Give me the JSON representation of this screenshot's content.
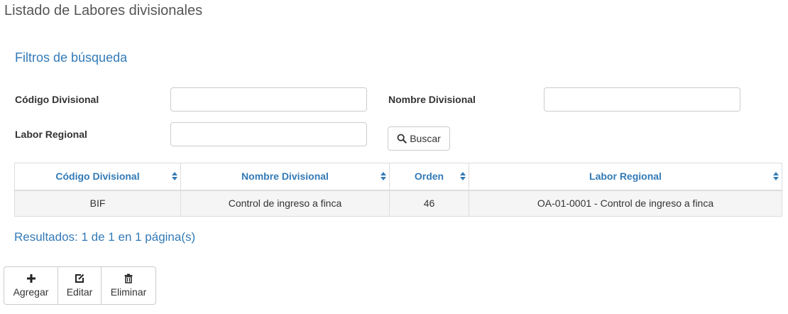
{
  "page": {
    "title": "Listado de Labores divisionales"
  },
  "filters": {
    "title": "Filtros de búsqueda",
    "codigo_label": "Código Divisional",
    "codigo_value": "",
    "nombre_label": "Nombre Divisional",
    "nombre_value": "",
    "labor_label": "Labor Regional",
    "labor_value": "",
    "search_label": "Buscar"
  },
  "table": {
    "columns": [
      "Código Divisional",
      "Nombre Divisional",
      "Orden",
      "Labor Regional"
    ],
    "rows": [
      [
        "BIF",
        "Control de ingreso a finca",
        "46",
        "OA-01-0001 - Control de ingreso a finca"
      ]
    ]
  },
  "results": {
    "text": "Resultados: 1 de 1 en 1 página(s)"
  },
  "toolbar": {
    "add_label": "Agregar",
    "edit_label": "Editar",
    "delete_label": "Eliminar"
  },
  "colors": {
    "accent": "#337ab7",
    "border": "#dddddd",
    "row_bg": "#f5f5f5"
  }
}
